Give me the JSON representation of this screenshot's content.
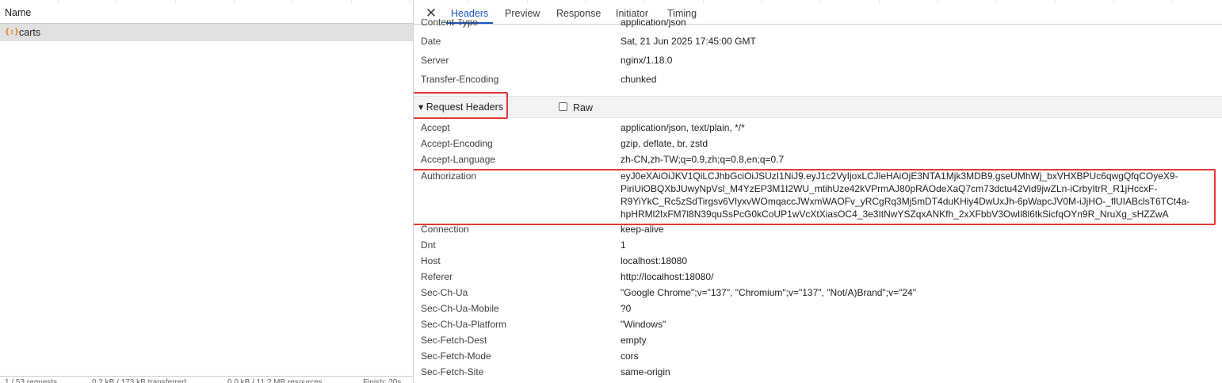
{
  "list": {
    "column_name": "Name",
    "request_name": "carts",
    "request_icon": "{:}",
    "status_bar": [
      "1 / 53 requests",
      "0.2 kB / 173 kB transferred",
      "0.0 kB / 11.2 MB resources",
      "Finish: 20s"
    ]
  },
  "tabs": [
    "Headers",
    "Preview",
    "Response",
    "Initiator",
    "Timing"
  ],
  "active_tab": "Headers",
  "response_headers": {
    "partial": {
      "key": "Content-Type",
      "value": "application/json"
    },
    "rows": [
      {
        "key": "Date",
        "value": "Sat, 21 Jun 2025 17:45:00 GMT"
      },
      {
        "key": "Server",
        "value": "nginx/1.18.0"
      },
      {
        "key": "Transfer-Encoding",
        "value": "chunked"
      }
    ]
  },
  "request_headers": {
    "title": "Request Headers",
    "raw_label": "Raw",
    "raw_checked": false,
    "top_rows": [
      {
        "key": "Accept",
        "value": "application/json, text/plain, */*"
      },
      {
        "key": "Accept-Encoding",
        "value": "gzip, deflate, br, zstd"
      },
      {
        "key": "Accept-Language",
        "value": "zh-CN,zh-TW;q=0.9,zh;q=0.8,en;q=0.7"
      }
    ],
    "authorization": {
      "key": "Authorization",
      "value_lines": [
        "eyJ0eXAiOiJKV1QiLCJhbGciOiJSUzI1NiJ9.eyJ1c2VyIjoxLCJleHAiOjE3NTA1Mjk3MDB9.gseUMhWj_bxVHXBPUc6qwgQfqCOyeX9-",
        "PiriUiOBQXbJUwyNpVsl_M4YzEP3M1I2WU_mtihUze42kVPrmAJ80pRAOdeXaQ7cm73dctu42Vid9jwZLn-iCrbyItrR_R1jHccxF-",
        "R9YiYkC_Rc5zSdTirgsv6VIyxvWOmqaccJWxmWAOFv_yRCgRq3Mj5mDT4duKHiy4DwUxJh-6pWapcJV0M-iJjHO-_flUIABclsT6TCt4a-",
        "hpHRMl2IxFM7l8N39quSsPcG0kCoUP1wVcXtXiasOC4_3e3ItNwYSZqxANKfh_2xXFbbV3OwIl8l6tkSicfqOYn9R_NruXg_sHZZwA"
      ]
    },
    "bottom_rows": [
      {
        "key": "Connection",
        "value": "keep-alive"
      },
      {
        "key": "Dnt",
        "value": "1"
      },
      {
        "key": "Host",
        "value": "localhost:18080"
      },
      {
        "key": "Referer",
        "value": "http://localhost:18080/"
      },
      {
        "key": "Sec-Ch-Ua",
        "value": "\"Google Chrome\";v=\"137\", \"Chromium\";v=\"137\", \"Not/A)Brand\";v=\"24\""
      },
      {
        "key": "Sec-Ch-Ua-Mobile",
        "value": "?0"
      },
      {
        "key": "Sec-Ch-Ua-Platform",
        "value": "\"Windows\""
      },
      {
        "key": "Sec-Fetch-Dest",
        "value": "empty"
      },
      {
        "key": "Sec-Fetch-Mode",
        "value": "cors"
      },
      {
        "key": "Sec-Fetch-Site",
        "value": "same-origin"
      }
    ]
  },
  "colors": {
    "accent": "#1a56c2",
    "highlight_box": "#e53935",
    "selected_row": "#e1e1e1"
  }
}
